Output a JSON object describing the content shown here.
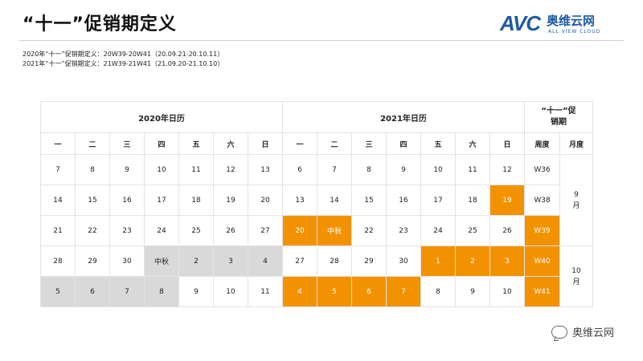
{
  "page": {
    "title": "“十一”促销期定义",
    "logo_mark": "AVC",
    "logo_cn": "奥维云网",
    "logo_en": "ALL VIEW CLOUD",
    "definitions": [
      "2020年“十一”促销期定义：20W39-20W41（20.09.21-20.10.11）",
      "2021年“十一”促销期定义：21W39-21W41（21.09.20-21.10.10）"
    ],
    "watermark": "奥维云网"
  },
  "colors": {
    "highlight": "#f39200",
    "gray_cell": "#d9d9d9",
    "brand": "#1f5aa6"
  },
  "calendar": {
    "header_2020": "2020年日历",
    "header_2021": "2021年日历",
    "header_promo": "“十一”促销期",
    "weekdays": [
      "一",
      "二",
      "三",
      "四",
      "五",
      "六",
      "日"
    ],
    "col_week": "周度",
    "col_month": "月度",
    "rows": [
      {
        "y2020": [
          "7",
          "8",
          "9",
          "10",
          "11",
          "12",
          "13"
        ],
        "y2021": [
          "6",
          "7",
          "8",
          "9",
          "10",
          "11",
          "12"
        ],
        "week": "W36"
      },
      {
        "y2020": [
          "14",
          "15",
          "16",
          "17",
          "18",
          "19",
          "20"
        ],
        "y2021": [
          "13",
          "14",
          "15",
          "16",
          "17",
          "18",
          "19"
        ],
        "week": "W38"
      },
      {
        "y2020": [
          "21",
          "22",
          "23",
          "24",
          "25",
          "26",
          "27"
        ],
        "y2021": [
          "20",
          "中秋",
          "22",
          "23",
          "24",
          "25",
          "26"
        ],
        "week": "W39"
      },
      {
        "y2020": [
          "28",
          "29",
          "30",
          "中秋",
          "2",
          "3",
          "4"
        ],
        "y2021": [
          "27",
          "28",
          "29",
          "30",
          "1",
          "2",
          "3"
        ],
        "week": "W40"
      },
      {
        "y2020": [
          "5",
          "6",
          "7",
          "8",
          "9",
          "10",
          "11"
        ],
        "y2021": [
          "4",
          "5",
          "6",
          "7",
          "8",
          "9",
          "10"
        ],
        "week": "W41"
      }
    ],
    "months": [
      {
        "num": "9",
        "unit": "月"
      },
      {
        "num": "10",
        "unit": "月"
      }
    ]
  }
}
